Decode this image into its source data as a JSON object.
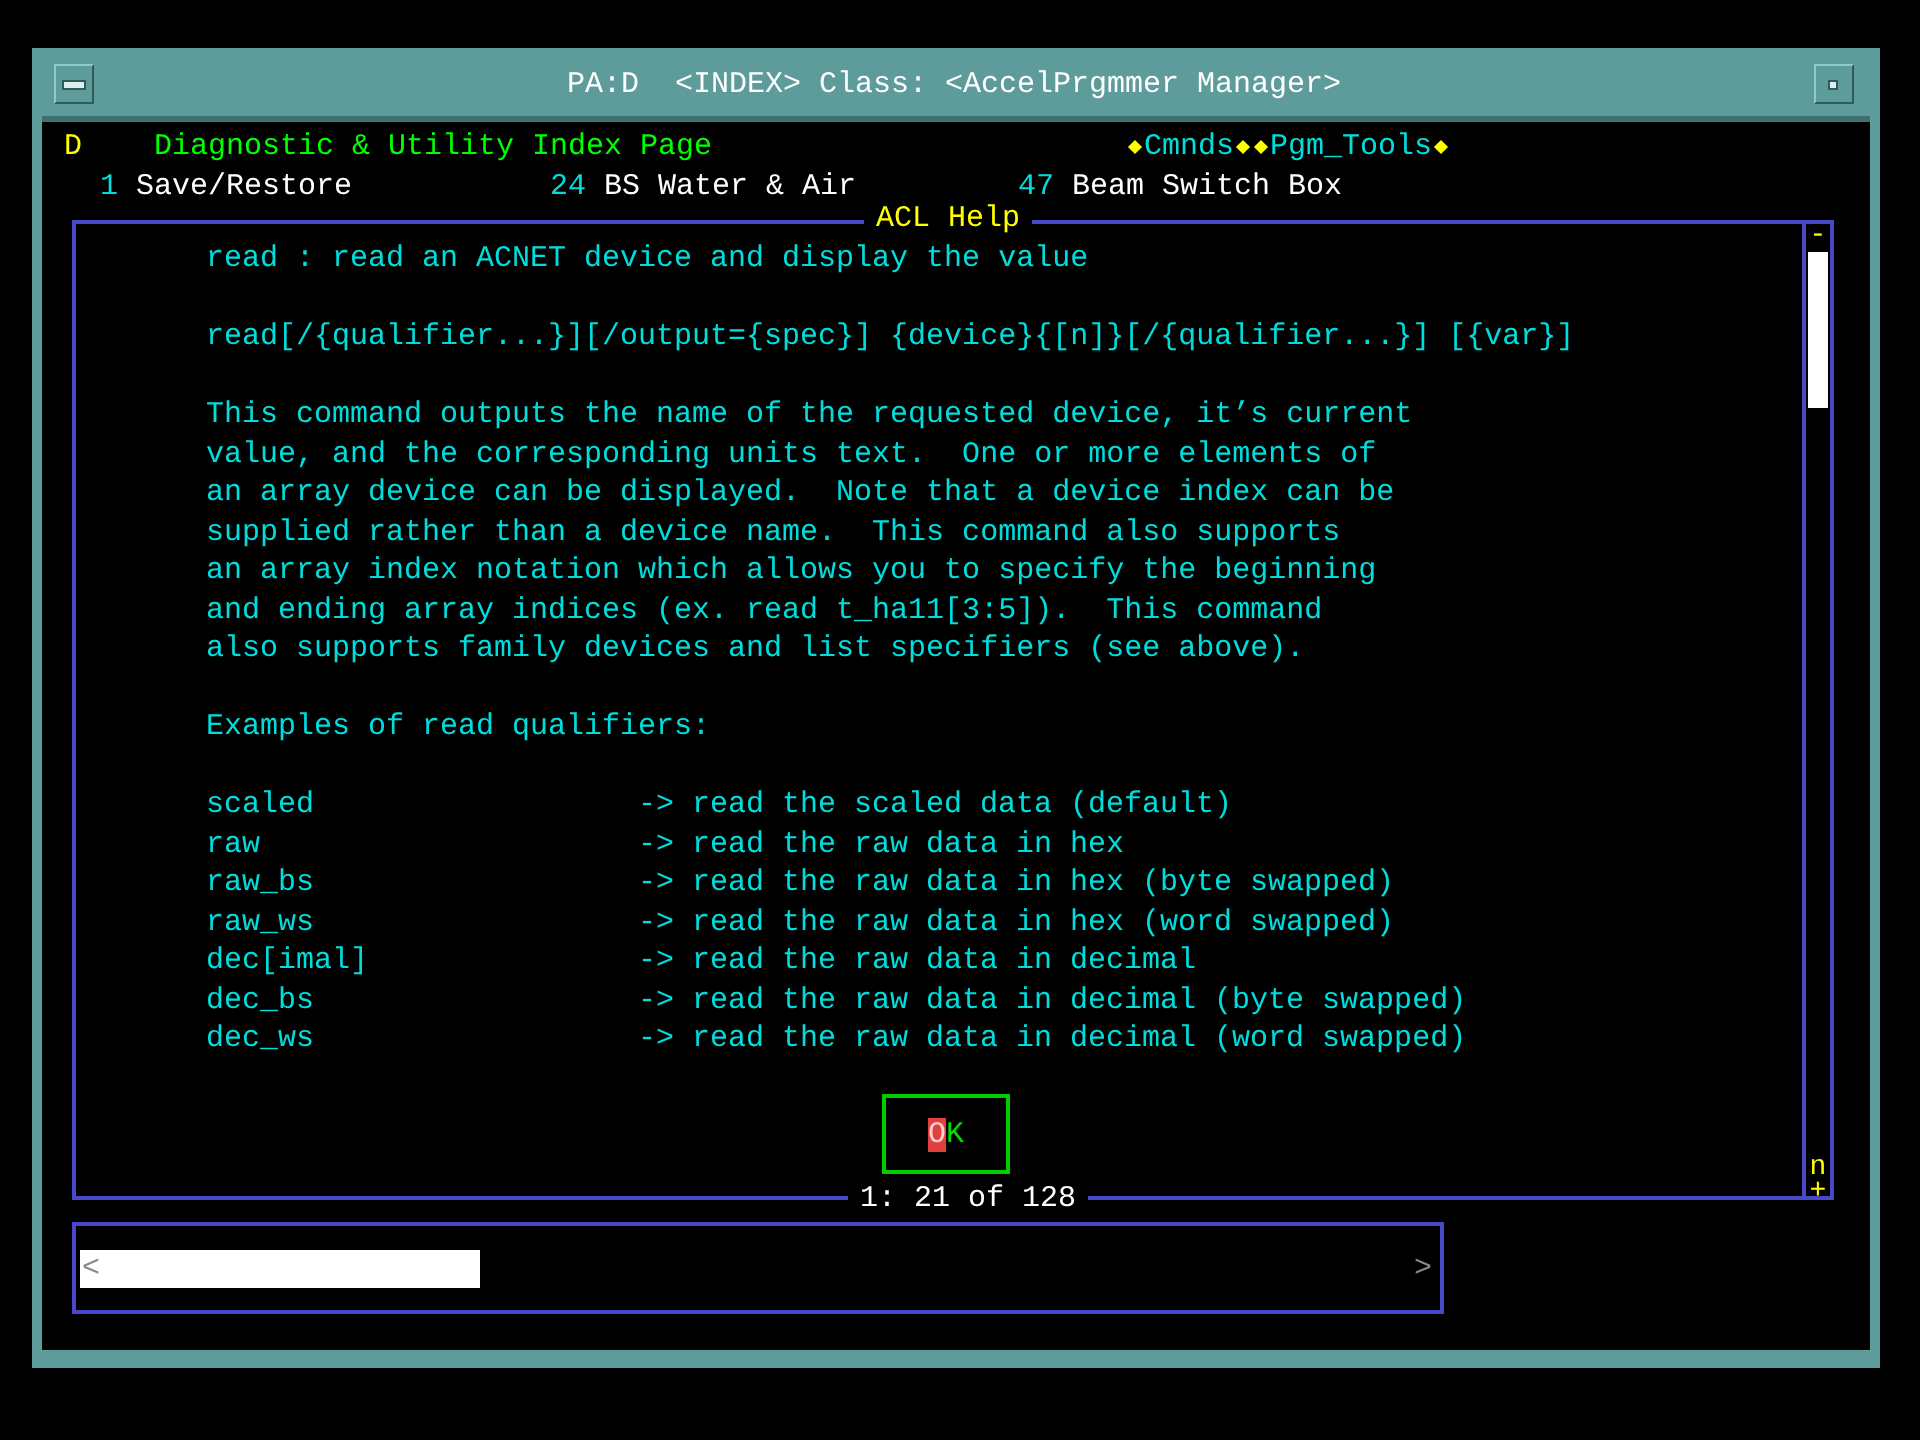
{
  "window": {
    "title": "PA:D  <INDEX> Class: <AccelPrgmmer Manager>"
  },
  "header": {
    "page_letter": "D",
    "page_title": "Diagnostic & Utility Index Page",
    "menus": [
      "Cmnds",
      "Pgm_Tools"
    ]
  },
  "shortcuts": [
    {
      "number": "1",
      "label": "Save/Restore"
    },
    {
      "number": "24",
      "label": "BS Water & Air"
    },
    {
      "number": "47",
      "label": "Beam Switch Box"
    }
  ],
  "help_dialog": {
    "title": "ACL Help",
    "blocks": [
      {
        "kind": "text",
        "lines": [
          "read : read an ACNET device and display the value"
        ]
      },
      {
        "kind": "text",
        "lines": [
          "read[/{qualifier...}][/output={spec}] {device}{[n]}[/{qualifier...}] [{var}]"
        ]
      },
      {
        "kind": "text",
        "lines": [
          "This command outputs the name of the requested device, it’s current",
          "value, and the corresponding units text.  One or more elements of",
          "an array device can be displayed.  Note that a device index can be",
          "supplied rather than a device name.  This command also supports",
          "an array index notation which allows you to specify the beginning",
          "and ending array indices (ex. read t_ha11[3:5]).  This command",
          "also supports family devices and list specifiers (see above)."
        ]
      },
      {
        "kind": "text",
        "lines": [
          "Examples of read qualifiers:"
        ]
      },
      {
        "kind": "table",
        "rows": [
          {
            "name": "scaled",
            "description": "-> read the scaled data (default)"
          },
          {
            "name": "raw",
            "description": "-> read the raw data in hex"
          },
          {
            "name": "raw_bs",
            "description": "-> read the raw data in hex (byte swapped)"
          },
          {
            "name": "raw_ws",
            "description": "-> read the raw data in hex (word swapped)"
          },
          {
            "name": "dec[imal]",
            "description": "-> read the raw data in decimal"
          },
          {
            "name": "dec_bs",
            "description": "-> read the raw data in decimal (byte swapped)"
          },
          {
            "name": "dec_ws",
            "description": "-> read the raw data in decimal (word swapped)"
          }
        ]
      }
    ],
    "ok_button": {
      "label": "OK",
      "cursor": true
    },
    "position": "1: 21 of 128",
    "scrollbar": {
      "top": "-",
      "bottom_letter": "n",
      "bottom": "+"
    }
  },
  "input_line": {
    "left": "<",
    "right": ">"
  }
}
